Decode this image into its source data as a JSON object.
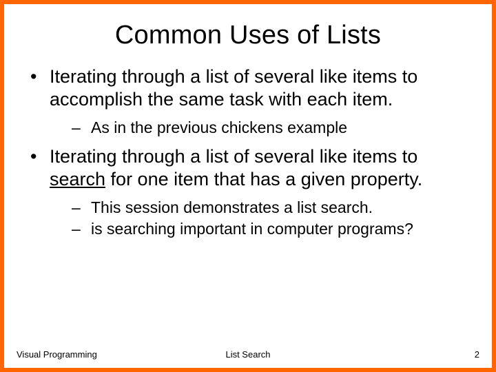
{
  "title": "Common Uses of Lists",
  "bullets": [
    {
      "text": "Iterating through a list of several like items to accomplish the same task with each item.",
      "sub": [
        "As in the previous chickens example"
      ]
    },
    {
      "text_before": "Iterating through a list of several like items to ",
      "text_underline": "search",
      "text_after": " for one item that has a given property.",
      "sub": [
        "This session demonstrates a list search.",
        "is searching important in computer programs?"
      ]
    }
  ],
  "footer": {
    "left": "Visual Programming",
    "center": "List Search",
    "right": "2"
  }
}
